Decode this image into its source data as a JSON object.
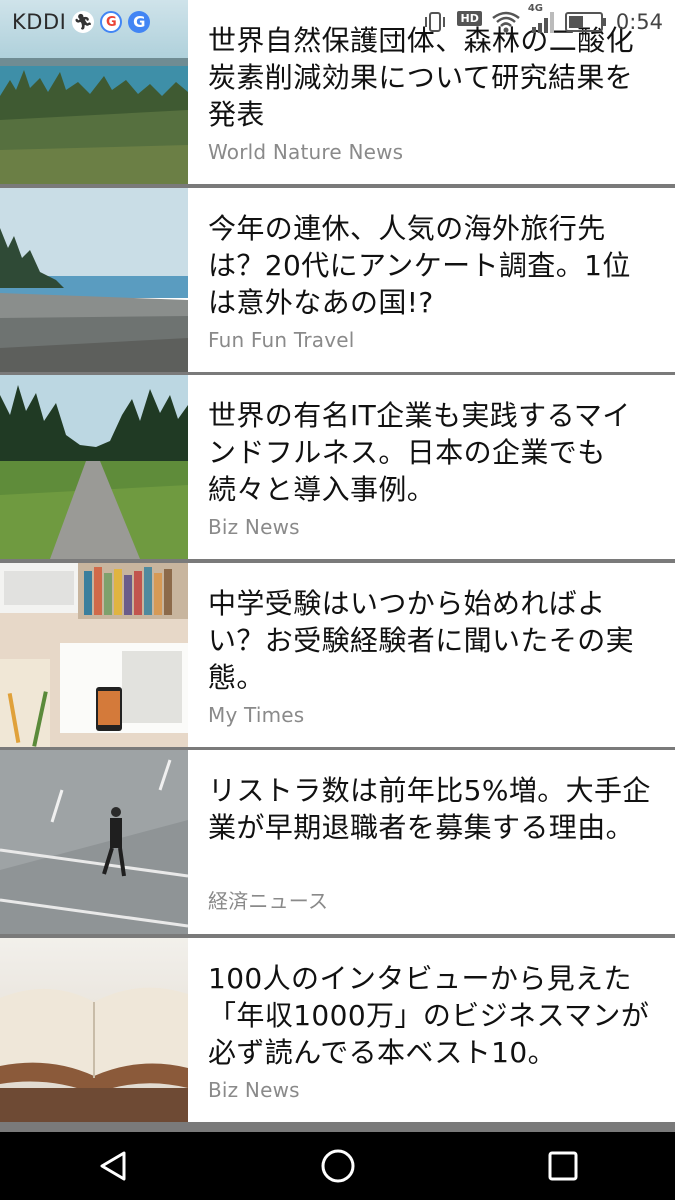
{
  "status_bar": {
    "carrier": "KDDI",
    "network": "4G",
    "hd": "HD",
    "time": "0:54",
    "notifications": [
      "running-man-icon",
      "google-icon",
      "google-icon"
    ]
  },
  "articles": [
    {
      "headline": "世界自然保護団体、森林の二酸化炭素削減効果について研究結果を発表",
      "source": "World Nature News",
      "thumbnail": "forest-lake-photo"
    },
    {
      "headline": "今年の連休、人気の海外旅行先は？20代にアンケート調査。1位は意外なあの国!?",
      "source": "Fun Fun Travel",
      "thumbnail": "beach-photo"
    },
    {
      "headline": "世界の有名IT企業も実践するマインドフルネス。日本の企業でも続々と導入事例。",
      "source": "Biz News",
      "thumbnail": "path-in-park-photo"
    },
    {
      "headline": "中学受験はいつから始めればよい？お受験経験者に聞いたその実態。",
      "source": "My Times",
      "thumbnail": "desk-books-photo"
    },
    {
      "headline": "リストラ数は前年比5%増。大手企業が早期退職者を募集する理由。",
      "source": "経済ニュース",
      "thumbnail": "businessman-street-photo"
    },
    {
      "headline": "100人のインタビューから見えた「年収1000万」のビジネスマンが必ず読んでる本ベスト10。",
      "source": "Biz News",
      "thumbnail": "open-book-photo"
    }
  ],
  "nav": [
    "back-icon",
    "home-icon",
    "recents-icon"
  ]
}
